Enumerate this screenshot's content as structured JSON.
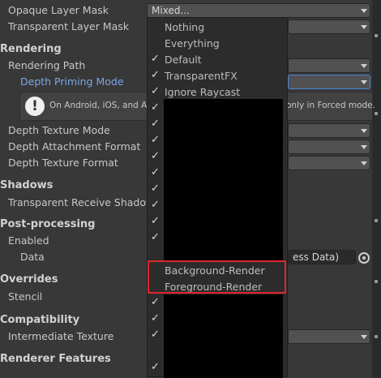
{
  "fields": {
    "opaque_layer_mask": {
      "label": "Opaque Layer Mask",
      "value": "Mixed..."
    },
    "transparent_layer_mask": {
      "label": "Transparent Layer Mask"
    }
  },
  "sections": {
    "rendering": "Rendering",
    "rendering_path": "Rendering Path",
    "depth_priming_mode": "Depth Priming Mode",
    "warning_text_left": "On Android, iOS, and App",
    "warning_text_right": "only in Forced mode.",
    "depth_texture_mode": "Depth Texture Mode",
    "depth_attachment_format": "Depth Attachment Format",
    "depth_texture_format": "Depth Texture Format",
    "shadows": "Shadows",
    "transparent_receive_shadows": "Transparent Receive Shadows",
    "post_processing": "Post-processing",
    "enabled": "Enabled",
    "data": "Data",
    "data_value_partial": "ess Data)",
    "overrides": "Overrides",
    "stencil": "Stencil",
    "compatibility": "Compatibility",
    "intermediate_texture": "Intermediate Texture",
    "renderer_features": "Renderer Features"
  },
  "dropdown": {
    "items": [
      {
        "label": "Nothing",
        "checked": false
      },
      {
        "label": "Everything",
        "checked": false
      },
      {
        "label": "Default",
        "checked": true
      },
      {
        "label": "TransparentFX",
        "checked": true
      },
      {
        "label": "Ignore Raycast",
        "checked": true
      },
      {
        "label": "Background-Render",
        "checked": false
      },
      {
        "label": "Foreground-Render",
        "checked": false
      }
    ],
    "check_glyph": "✓"
  },
  "icons": {
    "warning": "!"
  }
}
